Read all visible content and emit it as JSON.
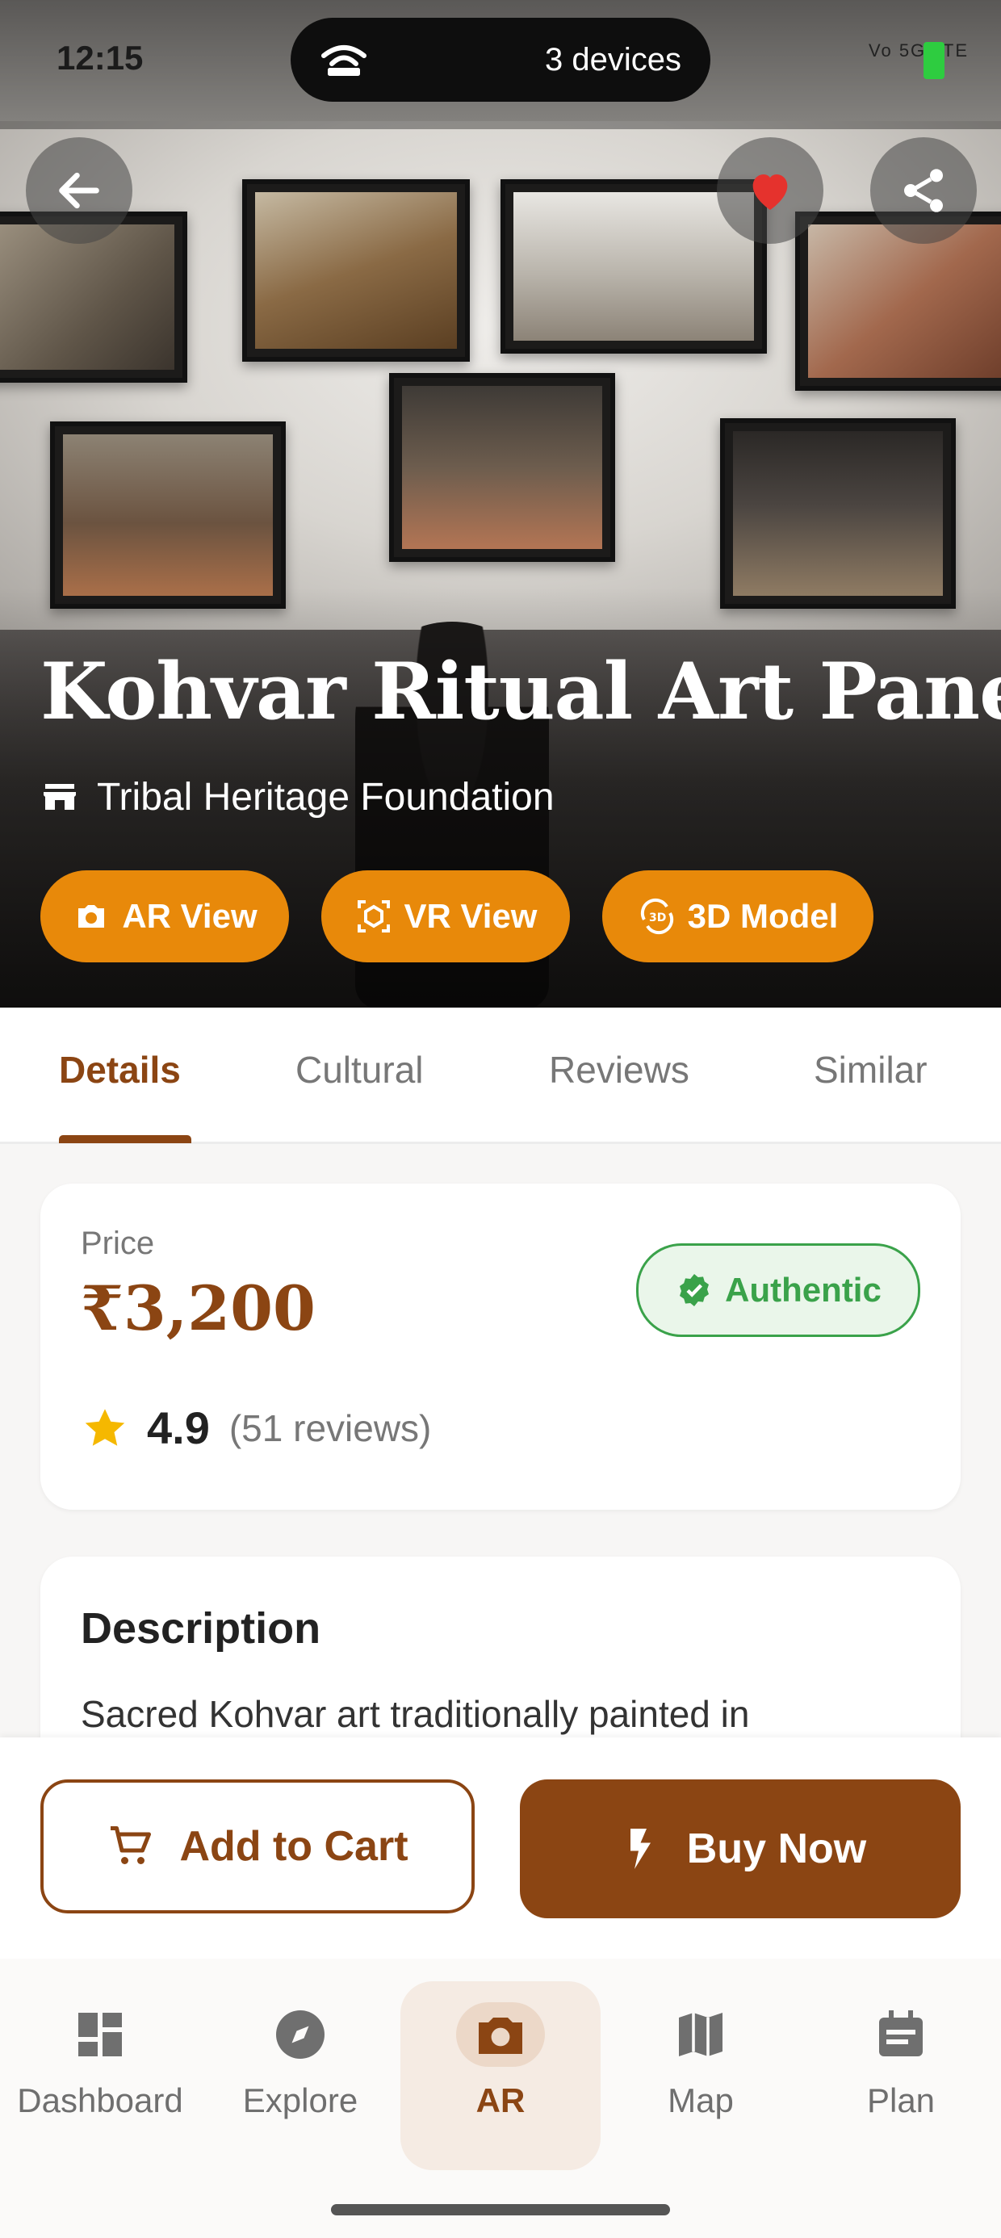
{
  "status_bar": {
    "time": "12:15",
    "hotspot_label": "3 devices",
    "network": "Vo 5G LTE"
  },
  "hero": {
    "title": "Kohvar Ritual Art Panel",
    "store_name": "Tribal Heritage Foundation",
    "actions": [
      {
        "label": "AR View",
        "icon": "camera-icon"
      },
      {
        "label": "VR View",
        "icon": "vr-cube-icon"
      },
      {
        "label": "3D Model",
        "icon": "3d-rotate-icon"
      }
    ],
    "favorite_active": true
  },
  "tabs": [
    {
      "label": "Details",
      "active": true
    },
    {
      "label": "Cultural",
      "active": false
    },
    {
      "label": "Reviews",
      "active": false
    },
    {
      "label": "Similar",
      "active": false
    }
  ],
  "price_card": {
    "price_label": "Price",
    "price_value": "₹3,200",
    "badge": "Authentic",
    "rating": "4.9",
    "reviews": "(51 reviews)"
  },
  "description": {
    "title": "Description",
    "text": "Sacred Kohvar art traditionally painted in"
  },
  "actions": {
    "add_to_cart": "Add to Cart",
    "buy_now": "Buy Now"
  },
  "bottom_nav": [
    {
      "label": "Dashboard",
      "icon": "dashboard-icon",
      "active": false
    },
    {
      "label": "Explore",
      "icon": "compass-icon",
      "active": false
    },
    {
      "label": "AR",
      "icon": "camera-icon",
      "active": true
    },
    {
      "label": "Map",
      "icon": "map-icon",
      "active": false
    },
    {
      "label": "Plan",
      "icon": "calendar-icon",
      "active": false
    }
  ],
  "colors": {
    "brand_brown": "#8b4513",
    "accent_orange": "#e8890a",
    "authentic_green": "#3aa24a",
    "favorite_red": "#e5322d",
    "star_yellow": "#f5b800"
  }
}
